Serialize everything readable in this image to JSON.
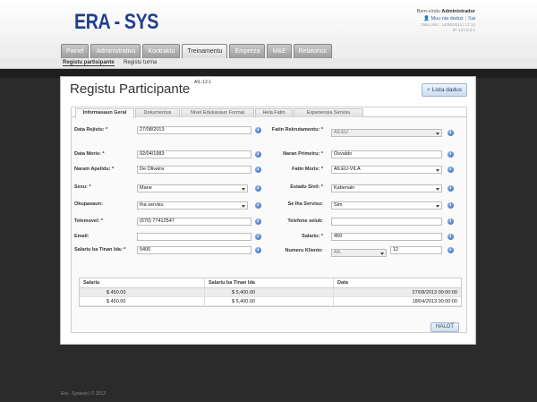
{
  "app": {
    "logo": "ERA - SYS"
  },
  "user": {
    "welcome": "Bem-vindu",
    "name": "Administrador",
    "link_change_password": "Muu nia dadus",
    "link_logout": "Sai",
    "date_line": "Data ohin : 14/08/2014 | 17:14",
    "ip_line": "IP: 127.0.0.1"
  },
  "nav": {
    "tabs": [
      "Painel",
      "Administrativu",
      "Kontraktu",
      "Treinamentu",
      "Empreza",
      "M&E",
      "Relatorius"
    ],
    "active": "Treinamentu"
  },
  "subnav": {
    "items": [
      "Registu partisipante",
      "Registu turma"
    ]
  },
  "panel": {
    "title": "Registu Participante",
    "code": "AIL-12-1",
    "list_button": "Lista dadus"
  },
  "form_tabs": [
    "Informasaun Geral",
    "Dokumentus",
    "Nivel Edukasaun Formal",
    "Hela Fatin",
    "Esperiensia Servisu"
  ],
  "form": {
    "data_rejistu": {
      "label": "Data Rejistu: *",
      "value": "27/08/2013"
    },
    "fatin_rekrutamentu": {
      "label": "Fatin Rekrutamentu: *",
      "value": "AILEU"
    },
    "data_moris": {
      "label": "Data Moris: *",
      "value": "02/04/1983"
    },
    "naran_primeiru": {
      "label": "Naran Primeiru: *",
      "value": "Osvaldo"
    },
    "naran_apelidu": {
      "label": "Naram Apelidu: *",
      "value": "De Oliveira"
    },
    "fatin_moris": {
      "label": "Fatin Moris: *",
      "value": "AILEU-VILA"
    },
    "sexu": {
      "label": "Sexu: *",
      "value": "Mane"
    },
    "estadu_sivil": {
      "label": "Estadu Sivil: *",
      "value": "Kabenain"
    },
    "okupasaun": {
      "label": "Okupasaun:",
      "value": "Iha servisu"
    },
    "se_iha_servisu": {
      "label": "Se Iha Servisu:",
      "value": "Sim"
    },
    "telemovel": {
      "label": "Telemovel: *",
      "value": "(670) 77412547"
    },
    "telefone_seluk": {
      "label": "Telefone seluk:",
      "value": ""
    },
    "email": {
      "label": "Email:",
      "value": ""
    },
    "salariu": {
      "label": "Salariu: *",
      "value": "450"
    },
    "salariu_tinan_ida": {
      "label": "Salariu ba Tinan Ida: *",
      "value": "5400"
    },
    "numeru_kliente": {
      "label": "Numeru Kliente:",
      "value_prefix": "AIL",
      "value": "12"
    }
  },
  "table": {
    "headers": [
      "Salariu",
      "Salariu ba Tinan Ida",
      "Data"
    ],
    "rows": [
      [
        "$ 450.00",
        "$ 5,400.00",
        "27/08/2013 00:00:00"
      ],
      [
        "$ 450.00",
        "$ 5,400.00",
        "18/04/2013 00:00:00"
      ]
    ]
  },
  "buttons": {
    "halot": "HALOT"
  },
  "footer": "Era - Sysweb | © 2012",
  "colors": {
    "logo": "#1f3f8f",
    "info_icon": "#2f65b8",
    "dark_bg": "#2b2b2b"
  }
}
